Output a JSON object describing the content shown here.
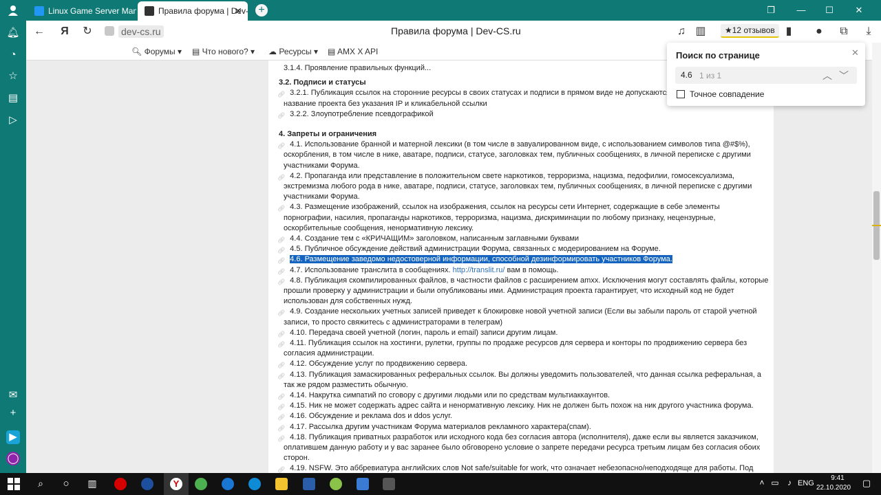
{
  "browser": {
    "tabs": [
      {
        "label": "Linux Game Server Manage",
        "active": false
      },
      {
        "label": "Правила форума | Dev-",
        "active": true
      }
    ],
    "url": "dev-cs.ru",
    "page_title": "Правила форума | Dev-CS.ru",
    "reviews": "★12 отзывов"
  },
  "forum_nav": {
    "items": [
      "Форумы",
      "Что нового?",
      "Ресурсы",
      "AMX X API"
    ]
  },
  "rules": [
    {
      "type": "cont",
      "text": "3.1.4. Проявление правильных функций..."
    },
    {
      "type": "h",
      "text": "3.2. Подписи и статусы"
    },
    {
      "type": "ind",
      "text": "3.2.1. Публикация ссылок на сторонние ресурсы в своих статусах и подписи в прямом виде не допускаются"
    },
    {
      "type": "cont",
      "text": "название проекта без указания IP и кликабельной ссылки"
    },
    {
      "type": "ind",
      "text": "3.2.2. Злоупотребление псевдографикой"
    },
    {
      "type": "h",
      "text": "4. Запреты и ограничения"
    },
    {
      "type": "ind",
      "text": "4.1. Использование бранной и матерной лексики (в том числе в завуалированном виде, с использованием символов типа @#$%),"
    },
    {
      "type": "cont",
      "text": "оскорбления, в том числе в нике, аватаре, подписи, статусе, заголовках тем, публичных сообщениях, в личной переписке с другими"
    },
    {
      "type": "cont",
      "text": "участниками Форума."
    },
    {
      "type": "ind",
      "text": "4.2. Пропаганда или представление в положительном свете наркотиков, терроризма, нацизма, педофилии, гомосексуализма,"
    },
    {
      "type": "cont",
      "text": "экстремизма любого рода в нике, аватаре, подписи, статусе, заголовках тем, публичных сообщениях, в личной переписке с другими"
    },
    {
      "type": "cont",
      "text": "участниками Форума."
    },
    {
      "type": "ind",
      "text": "4.3. Размещение изображений, ссылок на изображения, ссылок на ресурсы сети Интернет, содержащие в себе элементы"
    },
    {
      "type": "cont",
      "text": "порнографии, насилия, пропаганды наркотиков, терроризма, нацизма, дискриминации по любому признаку, нецензурные,"
    },
    {
      "type": "cont",
      "text": "оскорбительные сообщения, ненормативную лексику."
    },
    {
      "type": "ind",
      "text": "4.4. Создание тем с «КРИЧАЩИМ» заголовком, написанным заглавными буквами"
    },
    {
      "type": "ind",
      "text": "4.5. Публичное обсуждение действий администрации Форума, связанных с модерированием на Форуме."
    },
    {
      "type": "hl",
      "text": "4.6. Размещение заведомо недостоверной информации, способной дезинформировать участников Форума."
    },
    {
      "type": "link",
      "text": "4.7. Использование транслита в сообщениях.",
      "link": "http://translit.ru/",
      "after": " вам в помощь."
    },
    {
      "type": "ind",
      "text": "4.8. Публикация скомпилированных файлов, в частности файлов с расширением amxx. Исключения могут составлять файлы, которые"
    },
    {
      "type": "cont",
      "text": "прошли проверку у администрации и были опубликованы ими. Администрация проекта гарантирует, что исходный код не будет"
    },
    {
      "type": "cont",
      "text": "использован для собственных нужд."
    },
    {
      "type": "ind",
      "text": "4.9. Создание нескольких учетных записей приведет к блокировке новой учетной записи (Если вы забыли пароль от старой учетной"
    },
    {
      "type": "cont",
      "text": "записи, то просто свяжитесь с администраторами в телеграм)"
    },
    {
      "type": "ind",
      "text": "4.10. Передача своей учетной (логин, пароль и email) записи другим лицам."
    },
    {
      "type": "ind",
      "text": "4.11. Публикация ссылок на хостинги, рулетки, группы по продаже ресурсов для сервера и конторы по продвижению сервера без"
    },
    {
      "type": "cont",
      "text": "согласия администрации."
    },
    {
      "type": "ind",
      "text": "4.12. Обсуждение услуг по продвижению сервера."
    },
    {
      "type": "ind",
      "text": "4.13. Публикация замаскированных реферальных ссылок. Вы должны уведомить пользователей, что данная ссылка реферальная, а"
    },
    {
      "type": "cont",
      "text": "так же рядом разместить обычную."
    },
    {
      "type": "ind",
      "text": "4.14. Накрутка симпатий по сговору с другими людьми или по средствам мультиаккаунтов."
    },
    {
      "type": "ind",
      "text": "4.15. Ник не может содержать адрес сайта и ненормативную лексику. Ник не должен быть похож на ник другого участника форума."
    },
    {
      "type": "ind",
      "text": "4.16. Обсуждение и реклама dos и ddos услуг."
    },
    {
      "type": "ind",
      "text": "4.17. Рассылка другим участникам Форума материалов рекламного характера(спам)."
    },
    {
      "type": "ind",
      "text": "4.18. Публикация приватных разработок или исходного кода без согласия автора (исполнителя), даже если вы является заказчиком,"
    },
    {
      "type": "cont",
      "text": "оплатившем данную работу и у вас заранее было обговорено условие о запрете передачи ресурса третьим лицам без согласия обоих"
    },
    {
      "type": "cont",
      "text": "сторон."
    },
    {
      "type": "ind",
      "text": "4.19. NSFW. Это аббревиатура английских слов Not safe/suitable for work, что означает небезопасно/неподходяще для работы. Под"
    }
  ],
  "find_panel": {
    "title": "Поиск по странице",
    "query": "4.6",
    "count": "1 из 1",
    "exact_label": "Точное совпадение",
    "exact_checked": false
  },
  "taskbar": {
    "lang": "ENG",
    "time": "9:41",
    "date": "22.10.2020"
  },
  "colors": {
    "browser_accent": "#0f7a75",
    "highlight": "#1565c0",
    "link": "#2d6fb4"
  }
}
